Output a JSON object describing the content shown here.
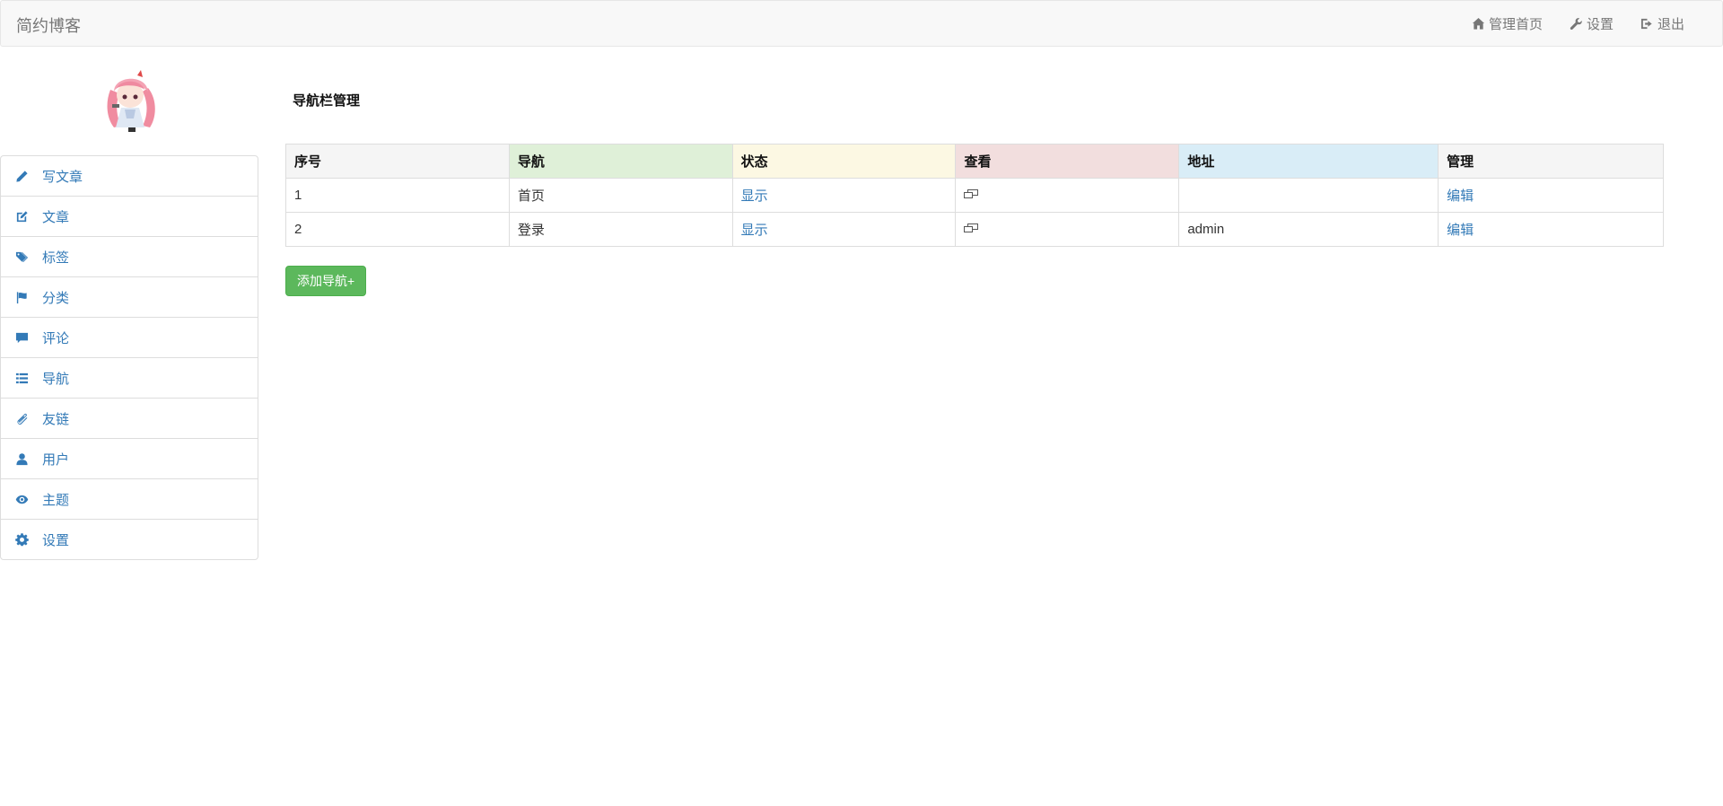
{
  "header": {
    "brand": "简约博客",
    "links": [
      {
        "label": "管理首页",
        "icon": "home-icon"
      },
      {
        "label": "设置",
        "icon": "wrench-icon"
      },
      {
        "label": "退出",
        "icon": "logout-icon"
      }
    ]
  },
  "avatar": {
    "icon": "avatar-image"
  },
  "sidebar": {
    "items": [
      {
        "label": "写文章",
        "icon": "pencil-icon"
      },
      {
        "label": "文章",
        "icon": "edit-icon"
      },
      {
        "label": "标签",
        "icon": "tags-icon"
      },
      {
        "label": "分类",
        "icon": "flag-icon"
      },
      {
        "label": "评论",
        "icon": "comment-icon"
      },
      {
        "label": "导航",
        "icon": "list-icon"
      },
      {
        "label": "友链",
        "icon": "paperclip-icon"
      },
      {
        "label": "用户",
        "icon": "user-icon"
      },
      {
        "label": "主题",
        "icon": "eye-icon"
      },
      {
        "label": "设置",
        "icon": "cog-icon"
      }
    ]
  },
  "main": {
    "title": "导航栏管理",
    "table": {
      "headers": [
        "序号",
        "导航",
        "状态",
        "查看",
        "地址",
        "管理"
      ],
      "rows": [
        {
          "index": "1",
          "nav": "首页",
          "status": "显示",
          "view_icon": "window-restore-icon",
          "address": "",
          "manage": "编辑"
        },
        {
          "index": "2",
          "nav": "登录",
          "status": "显示",
          "view_icon": "window-restore-icon",
          "address": "admin",
          "manage": "编辑"
        }
      ]
    },
    "add_button": "添加导航+"
  },
  "colors": {
    "link": "#337ab7",
    "navbar_bg": "#f8f8f8",
    "button_success": "#5cb85c",
    "th_active": "#f5f5f5",
    "th_success": "#dff0d8",
    "th_warning": "#fcf8e3",
    "th_danger": "#f2dede",
    "th_info": "#d9edf7"
  }
}
